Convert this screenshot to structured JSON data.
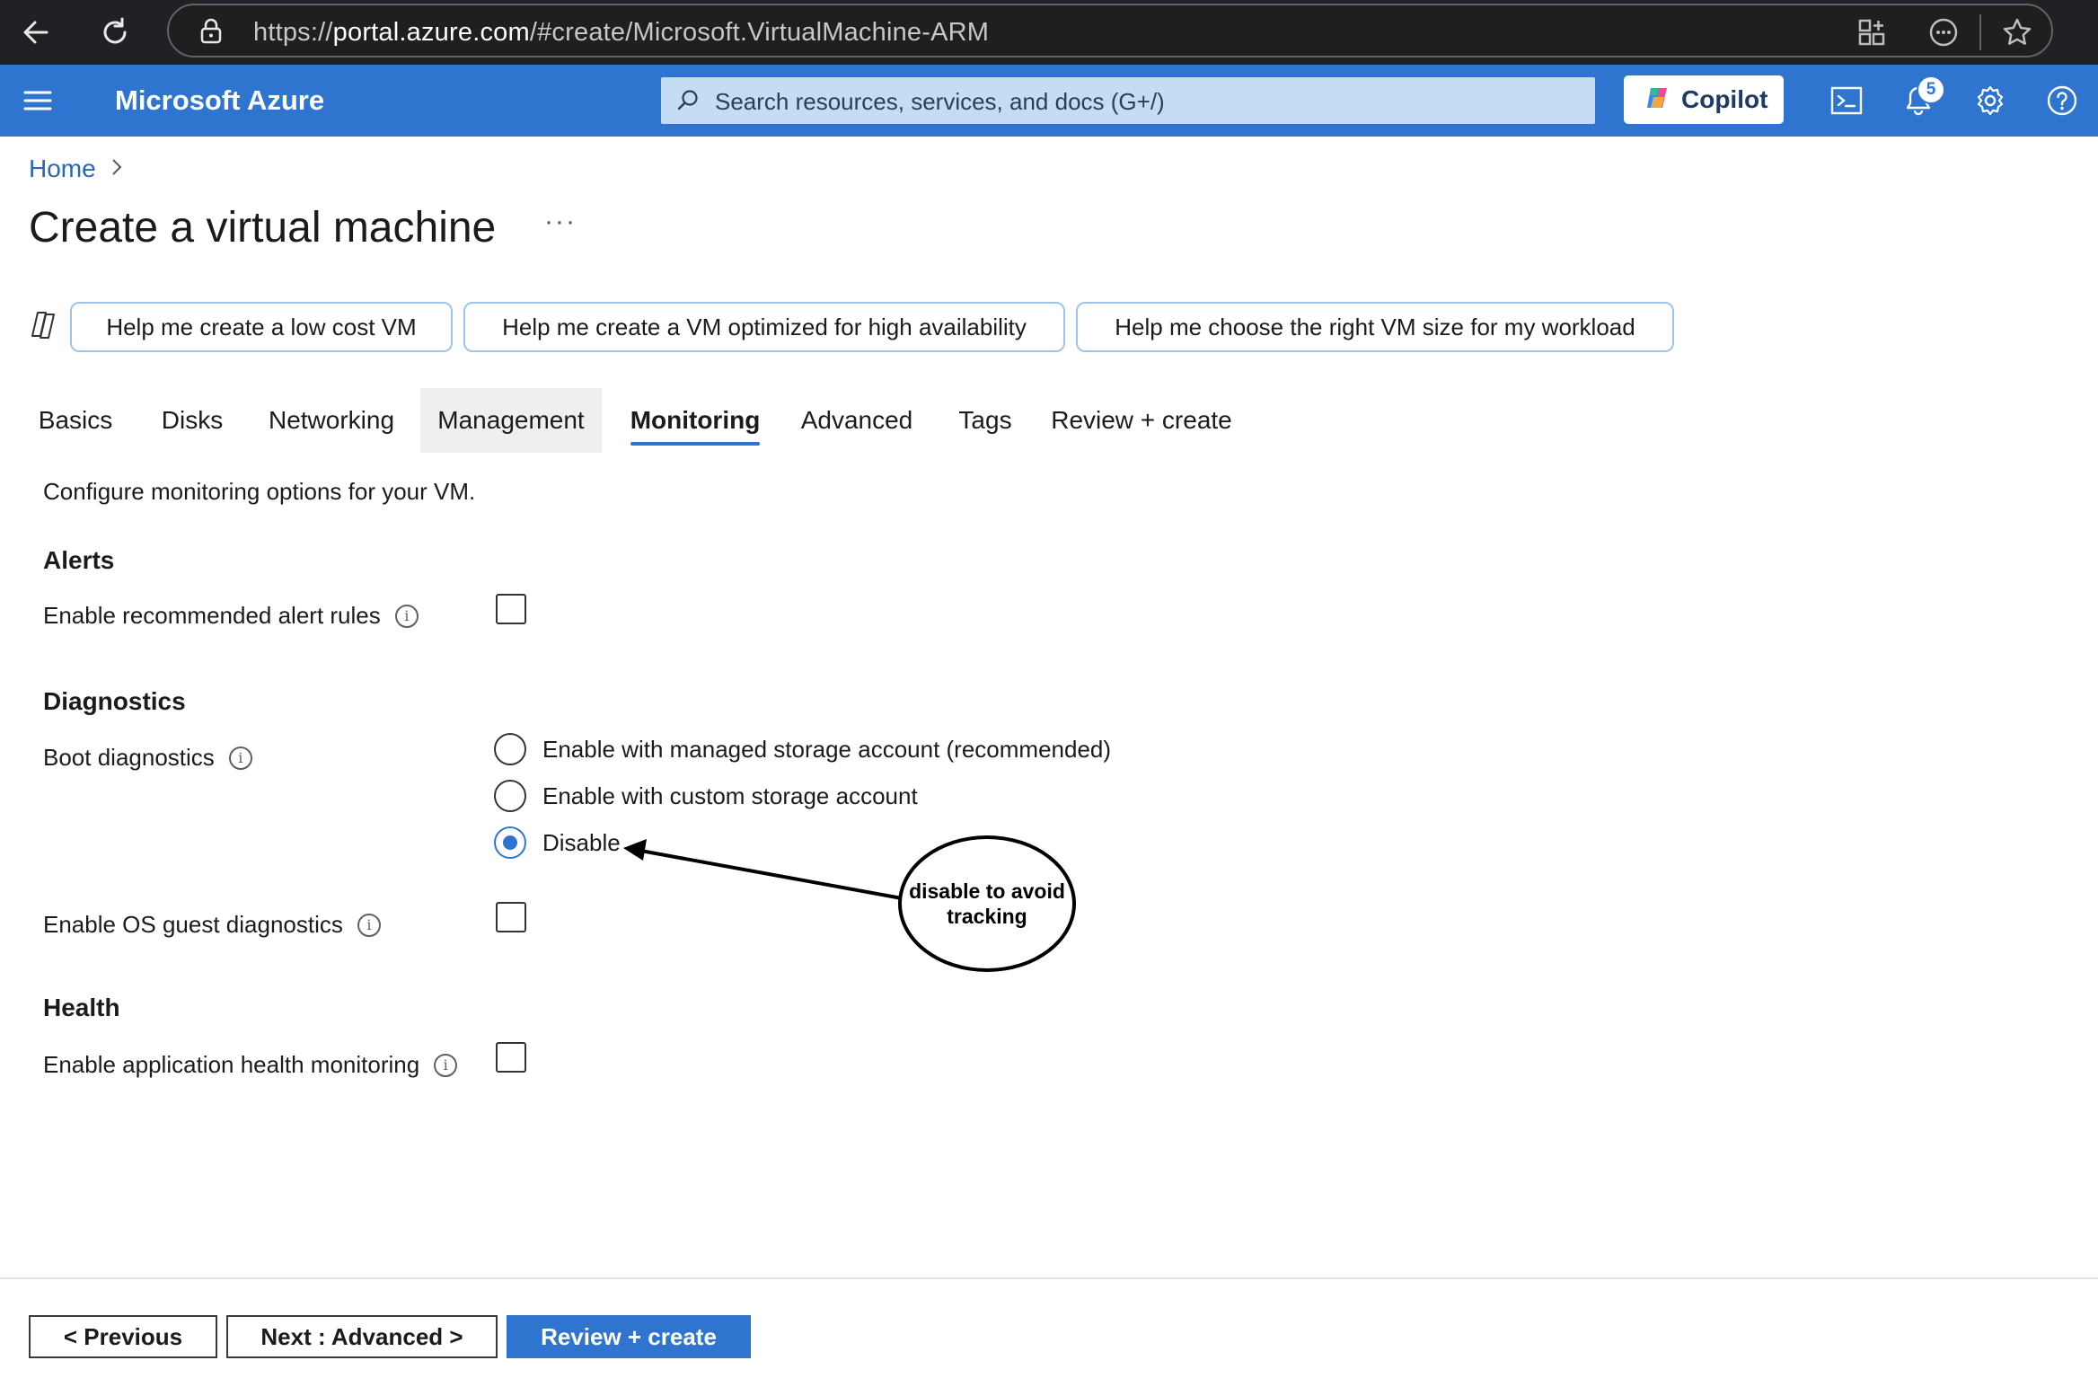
{
  "browser": {
    "url_scheme": "https://",
    "url_host": "portal.azure.com",
    "url_path": "/#create/Microsoft.VirtualMachine-ARM",
    "icons": [
      "back-arrow-icon",
      "refresh-icon",
      "lock-icon",
      "extensions-icon",
      "more-icon",
      "favorite-star-icon"
    ]
  },
  "header": {
    "brand": "Microsoft Azure",
    "search_placeholder": "Search resources, services, and docs (G+/)",
    "copilot_label": "Copilot",
    "notification_count": "5",
    "colors": {
      "header_bg": "#2f75cf",
      "search_bg": "#c4dcf4"
    }
  },
  "breadcrumb": {
    "home": "Home"
  },
  "page": {
    "title": "Create a virtual machine",
    "more": "···"
  },
  "suggestions": [
    "Help me create a low cost VM",
    "Help me create a VM optimized for high availability",
    "Help me choose the right VM size for my workload"
  ],
  "tabs": [
    {
      "label": "Basics"
    },
    {
      "label": "Disks"
    },
    {
      "label": "Networking"
    },
    {
      "label": "Management"
    },
    {
      "label": "Monitoring"
    },
    {
      "label": "Advanced"
    },
    {
      "label": "Tags"
    },
    {
      "label": "Review + create"
    }
  ],
  "active_tab": "Monitoring",
  "content": {
    "intro": "Configure monitoring options for your VM.",
    "alerts": {
      "heading": "Alerts",
      "enable_alert_rules_label": "Enable recommended alert rules",
      "enable_alert_rules_checked": false
    },
    "diagnostics": {
      "heading": "Diagnostics",
      "boot_label": "Boot diagnostics",
      "boot_options": [
        "Enable with managed storage account (recommended)",
        "Enable with custom storage account",
        "Disable"
      ],
      "boot_selected": "Disable",
      "os_guest_label": "Enable OS guest diagnostics",
      "os_guest_checked": false
    },
    "health": {
      "heading": "Health",
      "app_health_label": "Enable application health monitoring",
      "app_health_checked": false
    }
  },
  "annotation": {
    "text_line1": "disable to avoid",
    "text_line2": "tracking"
  },
  "footer": {
    "previous": "< Previous",
    "next": "Next : Advanced >",
    "review": "Review + create"
  }
}
